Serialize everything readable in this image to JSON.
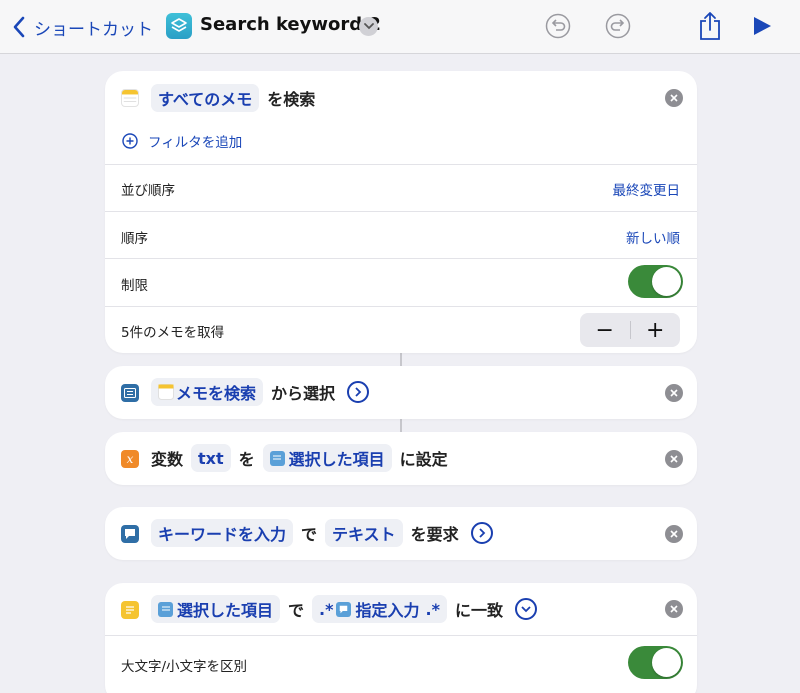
{
  "nav": {
    "back_label": "ショートカット",
    "title": "Search keyword 2"
  },
  "colors": {
    "accent": "#1a47b8",
    "toggle_on": "#3a8a3a",
    "variable_orange": "#f08a28",
    "notes_yellow": "#f5c431"
  },
  "find_notes": {
    "source_pill": "すべてのメモ",
    "suffix": "を検索",
    "add_filter": "フィルタを追加",
    "sort_label": "並び順序",
    "sort_value": "最終変更日",
    "order_label": "順序",
    "order_value": "新しい順",
    "limit_label": "制限",
    "limit_on": true,
    "get_label": "5件のメモを取得",
    "minus": "−",
    "plus": "+"
  },
  "choose": {
    "pill": "メモを検索",
    "suffix": "から選択"
  },
  "set_variable": {
    "prefix": "変数",
    "var_pill": "txt",
    "mid": "を",
    "value_pill": "選択した項目",
    "suffix": "に設定"
  },
  "ask_input": {
    "prompt_pill": "キーワードを入力",
    "mid": "で",
    "type_pill": "テキスト",
    "suffix": "を要求"
  },
  "match_text": {
    "input_pill": "選択した項目",
    "mid": "で",
    "pattern_prefix": ".*",
    "pattern_var": "指定入力",
    "pattern_suffix": ".*",
    "suffix": "に一致",
    "case_label": "大文字/小文字を区別",
    "case_on": true
  }
}
